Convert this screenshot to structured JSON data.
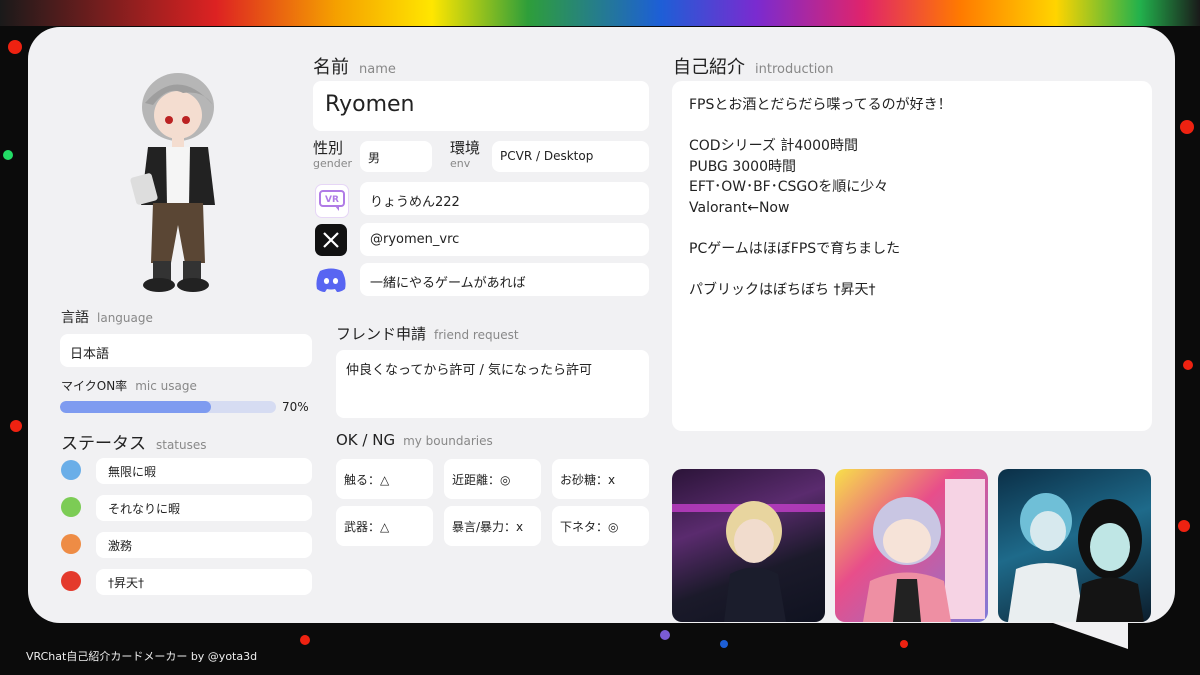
{
  "name": {
    "label": "名前",
    "label_en": "name",
    "value": "Ryomen"
  },
  "gender": {
    "label": "性別",
    "label_en": "gender",
    "value": "男"
  },
  "env": {
    "label": "環境",
    "label_en": "env",
    "value": "PCVR / Desktop"
  },
  "accounts": {
    "vrchat": {
      "icon": "vrchat-icon",
      "value": "りょうめん222"
    },
    "x": {
      "icon": "x-icon",
      "value": "@ryomen_vrc"
    },
    "discord": {
      "icon": "discord-icon",
      "value": "一緒にやるゲームがあれば"
    }
  },
  "friend_request": {
    "label": "フレンド申請",
    "label_en": "friend request",
    "value": "仲良くなってから許可 / 気になったら許可"
  },
  "boundaries": {
    "label": "OK / NG",
    "label_en": "my boundaries",
    "items": [
      "触る：△",
      "近距離：◎",
      "お砂糖：ⅹ",
      "武器：△",
      "暴言/暴力：ⅹ",
      "下ネタ：◎"
    ]
  },
  "language": {
    "label": "言語",
    "label_en": "language",
    "value": "日本語"
  },
  "mic": {
    "label": "マイクON率",
    "label_en": "mic usage",
    "percent": 70,
    "percent_text": "70%"
  },
  "statuses": {
    "label": "ステータス",
    "label_en": "statuses",
    "items": [
      {
        "color": "#6aaee8",
        "text": "無限に暇"
      },
      {
        "color": "#7ccc55",
        "text": "それなりに暇"
      },
      {
        "color": "#ee8c45",
        "text": "激務"
      },
      {
        "color": "#e43a2c",
        "text": "†昇天†"
      }
    ]
  },
  "intro": {
    "label": "自己紹介",
    "label_en": "introduction",
    "lines": [
      "FPSとお酒とだらだら喋ってるのが好き！",
      "",
      "CODシリーズ 計4000時間",
      "PUBG 3000時間",
      "EFT･OW･BF･CSGOを順に少々",
      "Valorant←Now",
      "",
      "PCゲームはほぼFPSで育ちました",
      "",
      "パブリックはぼちぼち †昇天†"
    ]
  },
  "footer": "VRChat自己紹介カードメーカー by @yota3d",
  "colors": {
    "mic_bar": "#7e9bf0",
    "vrchat": "#b07be6",
    "discord": "#5865f2"
  }
}
